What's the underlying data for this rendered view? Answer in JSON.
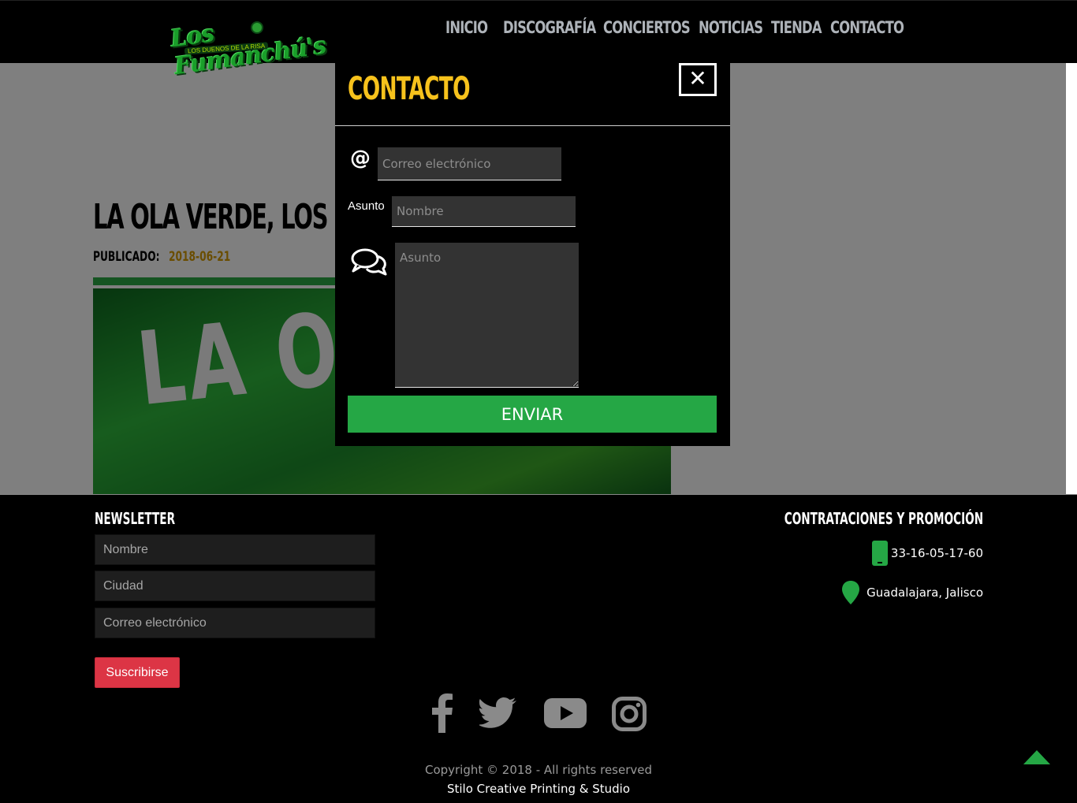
{
  "nav": {
    "items": [
      {
        "label": "INICIO"
      },
      {
        "label": "DISCOGRAFÍA"
      },
      {
        "label": "CONCIERTOS"
      },
      {
        "label": "NOTICIAS"
      },
      {
        "label": "TIENDA"
      },
      {
        "label": "CONTACTO"
      }
    ]
  },
  "logo": {
    "text": "Los Fumanchú's",
    "tagline": "LOS DUENOS DE LA RISA"
  },
  "post": {
    "title": "LA OLA VERDE, LOS FUMANCHÚ'S",
    "published_label": "PUBLICADO:",
    "date": "2018-06-21",
    "hero_text": "LA OLA VERDE"
  },
  "modal": {
    "title": "CONTACTO",
    "close_symbol": "✕",
    "email_placeholder": "Correo electrónico",
    "asunto_label": "Asunto",
    "nombre_placeholder": "Nombre",
    "message_placeholder": "Asunto",
    "send_label": "ENVIAR"
  },
  "newsletter": {
    "title": "NEWSLETTER",
    "nombre_placeholder": "Nombre",
    "ciudad_placeholder": "Ciudad",
    "email_placeholder": "Correo electrónico",
    "subscribe_label": "Suscribirse"
  },
  "contact": {
    "title": "CONTRATACIONES Y PROMOCIÓN",
    "phone": "33-16-05-17-60",
    "location": "Guadalajara, Jalisco"
  },
  "social": [
    "facebook-icon",
    "twitter-icon",
    "youtube-icon",
    "instagram-icon"
  ],
  "footer": {
    "copyright": "Copyright © 2018 - All rights reserved",
    "credit": "Stilo Creative Printing & Studio"
  },
  "colors": {
    "accent_green": "#25a745",
    "title_yellow": "#f7c21c",
    "date_gold": "#d49a00",
    "subscribe_red": "#dc3545"
  }
}
